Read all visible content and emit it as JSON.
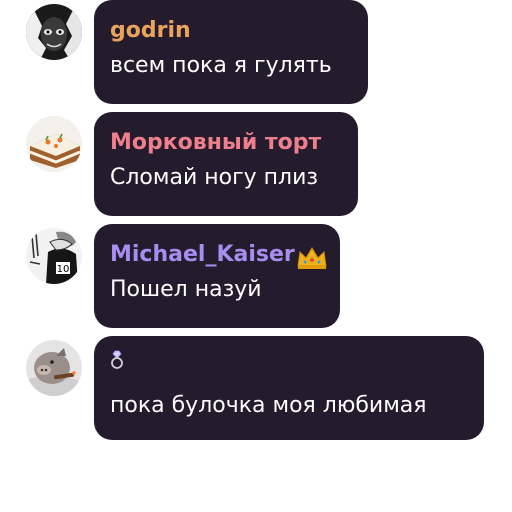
{
  "messages": [
    {
      "username": "godrin",
      "name_color": "#e9a35c",
      "text": "всем пока я гулять",
      "avatar_icon": "dark-manga-face-avatar"
    },
    {
      "username": "Морковный торт",
      "name_color": "#ef7f8c",
      "text": "Сломай ногу плиз",
      "avatar_icon": "carrot-cake-avatar"
    },
    {
      "username": "Michael_Kaiser",
      "name_color": "#a88df0",
      "text": "Пошел назуй",
      "badge_icon": "crown-icon",
      "avatar_icon": "manga-number-10-avatar"
    },
    {
      "username": "",
      "name_color": "#d8d8ff",
      "text": "пока булочка моя любимая",
      "badge_icon": "diamond-ring-icon",
      "avatar_icon": "pig-with-cigar-avatar"
    }
  ]
}
